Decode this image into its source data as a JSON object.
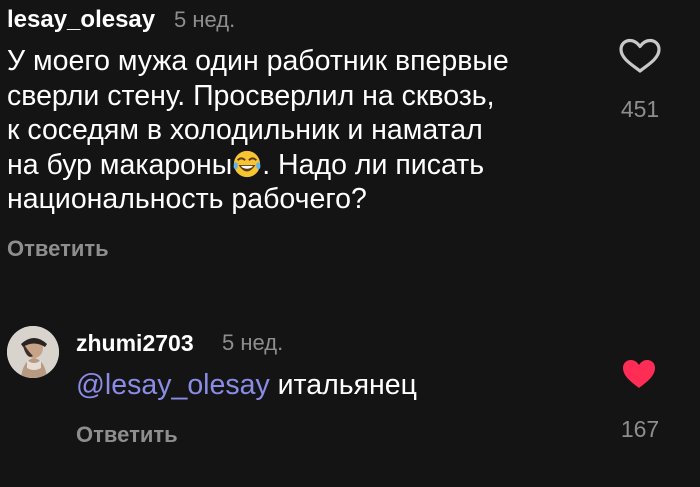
{
  "colors": {
    "background": "#141414",
    "primary_text": "#ffffff",
    "secondary_text": "#8e8e8e",
    "mention": "#8a8ce6",
    "liked_heart": "#ff2d55"
  },
  "comment": {
    "username": "lesay_olesay",
    "time": "5 нед.",
    "text_before_emoji": "У моего мужа один работник впервые\nсверли стену.  Просверлил на сквозь,\nк соседям  в холодильник  и наматал\nна бур макароны",
    "emoji": "face-with-tears-of-joy",
    "text_after_emoji": ". Надо ли  писать\nнациональность рабочего?",
    "reply_label": "Ответить",
    "like_icon": "heart-outline-icon",
    "like_count": "451",
    "liked": false
  },
  "reply": {
    "avatar": "user-avatar",
    "username": "zhumi2703",
    "time": "5 нед.",
    "mention": "@lesay_olesay",
    "text": " итальянец",
    "reply_label": "Ответить",
    "like_icon": "heart-filled-icon",
    "like_count": "167",
    "liked": true
  }
}
